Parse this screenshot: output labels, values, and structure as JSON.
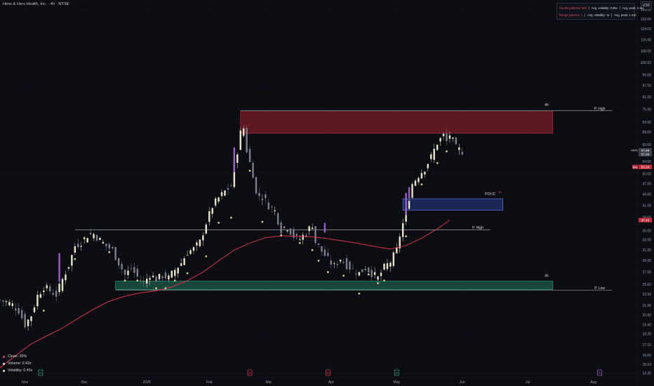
{
  "header": {
    "title": "Hims & Hers Health, Inc. · 4h · NYSE",
    "currency_button": "USD"
  },
  "info_box": {
    "row1": {
      "label": "Candle patterns: 503",
      "stat1": "Avg. volatility: 0.99x",
      "stat2": "Avg. peak: 2.11x"
    },
    "row2": {
      "label": "Range patterns: 1",
      "stat1": "Avg. volatility: 1x",
      "stat2": "Avg. peak: 1.42x"
    }
  },
  "legend": [
    {
      "label": "Close: 20%",
      "color": "#e04e6a"
    },
    {
      "label": "Volume: 0.42x",
      "color": "#e8e2c8"
    },
    {
      "label": "Volatility: 0.45x",
      "color": "#e8e2c8"
    }
  ],
  "colors": {
    "background": "#0b0d12",
    "up_candle": "#e8e2c8",
    "down_candle": "#7a7f8a",
    "ma_line": "#d9344f",
    "supply_zone": "#7a1c28",
    "demand_zone": "#1d5a4a",
    "poi_zone": "#1f2f6e",
    "purple_candle": "#9a5cc9",
    "price_badge": "#3a3f4a",
    "red_badge": "#c2303f"
  },
  "chart_data": {
    "type": "candlestick",
    "title": "Hims & Hers Health, Inc. · 4h · NYSE",
    "y_scale": "log",
    "ylim": [
      14.3,
      140
    ],
    "y_ticks": [
      "14.30",
      "15.10",
      "16.00",
      "17.10",
      "18.30",
      "19.40",
      "20.60",
      "21.90",
      "23.50",
      "25.00",
      "27.00",
      "29.00",
      "31.00",
      "33.00",
      "35.00",
      "38.00",
      "41.00",
      "44.00",
      "47.00",
      "50.00",
      "54.00",
      "57.00",
      "60.00",
      "65.00",
      "69.00",
      "75.00",
      "81.00",
      "87.00",
      "93.00",
      "100.50",
      "108.00",
      "116.00",
      "124.00",
      "132.00",
      "140.00"
    ],
    "y_tick_values": [
      14.3,
      15.1,
      16,
      17.1,
      18.3,
      19.4,
      20.6,
      21.9,
      23.5,
      25,
      27,
      29,
      31,
      33,
      35,
      38,
      41,
      44,
      47,
      50,
      54,
      57,
      60,
      65,
      69,
      75,
      81,
      87,
      93,
      100.5,
      108,
      116,
      124,
      132,
      140
    ],
    "x_labels": [
      "Nov",
      "Dec",
      "2025",
      "Feb",
      "Mar",
      "Apr",
      "May",
      "Jun",
      "Jul",
      "Aug"
    ],
    "x_label_index": [
      8,
      27,
      47,
      67,
      86,
      106,
      127,
      148,
      169,
      190
    ],
    "x_count": 205,
    "price_labels": [
      {
        "text": "HIMS",
        "value": 57.99,
        "kind": "ticker"
      },
      {
        "text": "57.99",
        "value": 57.99,
        "kind": "price"
      },
      {
        "text": "57.99",
        "value": 56.6,
        "kind": "price"
      },
      {
        "text": "52.24",
        "value": 52.24,
        "kind": "red"
      },
      {
        "text": "Box",
        "value": 52.24,
        "kind": "tag"
      },
      {
        "text": "37.42",
        "value": 37.42,
        "kind": "red"
      }
    ],
    "zones": [
      {
        "name": "supply",
        "from_index": 77,
        "to_index": 177,
        "low": 64.5,
        "high": 74.3
      },
      {
        "name": "poi",
        "from_index": 129,
        "to_index": 161,
        "low": 39.8,
        "high": 42.8
      },
      {
        "name": "demand",
        "from_index": 37,
        "to_index": 177,
        "low": 24.2,
        "high": 25.5
      }
    ],
    "levels": [
      {
        "name": "P. High",
        "value": 74.3,
        "from_index": 77,
        "to_index": 196,
        "label_index": 192
      },
      {
        "name": "P. High",
        "value": 35.2,
        "from_index": 24,
        "to_index": 157,
        "label_index": 153
      },
      {
        "name": "P. Low",
        "value": 24.1,
        "from_index": 37,
        "to_index": 196,
        "label_index": 192
      }
    ],
    "annotations": [
      {
        "text": "4h",
        "index": 175,
        "value": 76.5
      },
      {
        "text": "4h",
        "index": 175,
        "value": 26.2
      },
      {
        "text": "POI IC",
        "index": 157,
        "value": 43.8
      },
      {
        "text": "4H",
        "index": 160,
        "value": 44.4
      }
    ],
    "event_markers": [
      {
        "text": "D",
        "index": 13,
        "color": "#2a9d7a"
      },
      {
        "text": "E",
        "index": 80,
        "color": "#d9344f"
      },
      {
        "text": "D",
        "index": 105,
        "color": "#d9344f"
      },
      {
        "text": "D",
        "index": 127,
        "color": "#2a9d7a"
      },
      {
        "text": "E",
        "index": 192,
        "color": "#9a5cc9"
      }
    ],
    "close_path": [
      [
        0,
        22.6
      ],
      [
        2,
        22.4
      ],
      [
        4,
        22.0
      ],
      [
        6,
        21.2
      ],
      [
        8,
        19.4
      ],
      [
        10,
        20.6
      ],
      [
        12,
        23.3
      ],
      [
        14,
        24.6
      ],
      [
        16,
        24.0
      ],
      [
        18,
        23.4
      ],
      [
        20,
        25.8
      ],
      [
        22,
        28.2
      ],
      [
        24,
        31.8
      ],
      [
        26,
        32.6
      ],
      [
        28,
        34.0
      ],
      [
        30,
        34.3
      ],
      [
        32,
        33.0
      ],
      [
        34,
        31.8
      ],
      [
        36,
        31.0
      ],
      [
        38,
        28.6
      ],
      [
        40,
        26.5
      ],
      [
        42,
        27.6
      ],
      [
        44,
        26.2
      ],
      [
        46,
        25.2
      ],
      [
        48,
        26.6
      ],
      [
        50,
        25.8
      ],
      [
        52,
        26.4
      ],
      [
        54,
        26.0
      ],
      [
        56,
        27.4
      ],
      [
        58,
        28.6
      ],
      [
        60,
        30.6
      ],
      [
        62,
        31.2
      ],
      [
        64,
        32.6
      ],
      [
        66,
        36.8
      ],
      [
        68,
        40.8
      ],
      [
        70,
        43.0
      ],
      [
        72,
        44.8
      ],
      [
        74,
        46.4
      ],
      [
        75,
        54.0
      ],
      [
        76,
        57.8
      ],
      [
        77,
        64.6
      ],
      [
        78,
        66.6
      ],
      [
        79,
        58.0
      ],
      [
        80,
        53.6
      ],
      [
        81,
        50.0
      ],
      [
        82,
        44.0
      ],
      [
        84,
        43.4
      ],
      [
        86,
        41.0
      ],
      [
        88,
        39.6
      ],
      [
        90,
        35.2
      ],
      [
        92,
        35.8
      ],
      [
        94,
        33.8
      ],
      [
        96,
        33.2
      ],
      [
        98,
        34.6
      ],
      [
        100,
        36.4
      ],
      [
        101,
        32.6
      ],
      [
        103,
        30.8
      ],
      [
        105,
        29.2
      ],
      [
        107,
        28.0
      ],
      [
        109,
        29.4
      ],
      [
        111,
        28.2
      ],
      [
        113,
        27.4
      ],
      [
        115,
        26.8
      ],
      [
        117,
        27.8
      ],
      [
        119,
        26.8
      ],
      [
        121,
        26.0
      ],
      [
        123,
        27.8
      ],
      [
        125,
        28.8
      ],
      [
        127,
        31.0
      ],
      [
        128,
        34.0
      ],
      [
        129,
        36.6
      ],
      [
        130,
        39.6
      ],
      [
        131,
        43.2
      ],
      [
        132,
        47.0
      ],
      [
        134,
        49.6
      ],
      [
        136,
        51.8
      ],
      [
        138,
        55.6
      ],
      [
        140,
        60.8
      ],
      [
        142,
        63.6
      ],
      [
        143,
        61.2
      ],
      [
        144,
        64.0
      ],
      [
        146,
        58.8
      ],
      [
        148,
        57.6
      ]
    ],
    "ma_path": [
      [
        0,
        14.8
      ],
      [
        5,
        16.0
      ],
      [
        10,
        17.2
      ],
      [
        15,
        18.1
      ],
      [
        20,
        19.0
      ],
      [
        25,
        20.2
      ],
      [
        30,
        21.4
      ],
      [
        35,
        22.5
      ],
      [
        40,
        23.2
      ],
      [
        45,
        23.7
      ],
      [
        50,
        24.0
      ],
      [
        55,
        24.6
      ],
      [
        60,
        25.6
      ],
      [
        65,
        27.0
      ],
      [
        70,
        29.0
      ],
      [
        75,
        31.0
      ],
      [
        80,
        32.4
      ],
      [
        85,
        33.5
      ],
      [
        90,
        33.9
      ],
      [
        95,
        33.8
      ],
      [
        100,
        33.7
      ],
      [
        105,
        33.3
      ],
      [
        110,
        32.8
      ],
      [
        115,
        32.3
      ],
      [
        120,
        31.7
      ],
      [
        125,
        31.2
      ],
      [
        130,
        31.9
      ],
      [
        135,
        33.4
      ],
      [
        140,
        35.4
      ],
      [
        144,
        37.42
      ]
    ],
    "markers_below": [
      [
        14,
        21.2
      ],
      [
        24,
        29.3
      ],
      [
        35,
        30.6
      ],
      [
        40,
        25.6
      ],
      [
        44,
        25.6
      ],
      [
        50,
        24.4
      ],
      [
        53,
        24.4
      ],
      [
        56,
        25.6
      ],
      [
        60,
        26.8
      ],
      [
        66,
        29.8
      ],
      [
        70,
        36.8
      ],
      [
        74,
        38.0
      ],
      [
        80,
        51.0
      ],
      [
        84,
        37.0
      ],
      [
        90,
        34.0
      ],
      [
        96,
        32.4
      ],
      [
        100,
        31.0
      ],
      [
        102,
        29.0
      ],
      [
        105,
        27.0
      ],
      [
        110,
        26.4
      ],
      [
        115,
        23.6
      ],
      [
        118,
        26.6
      ],
      [
        121,
        25.2
      ],
      [
        123,
        25.6
      ],
      [
        127,
        30.5
      ],
      [
        130,
        33.8
      ],
      [
        135,
        46.8
      ],
      [
        140,
        53.5
      ],
      [
        143,
        57.6
      ]
    ],
    "purple_candles": [
      {
        "index": 19,
        "low": 25.5,
        "high": 30.4
      },
      {
        "index": 75,
        "low": 50.5,
        "high": 59.0
      },
      {
        "index": 104,
        "low": 34.6,
        "high": 36.8
      },
      {
        "index": 130,
        "low": 38.6,
        "high": 44.4
      },
      {
        "index": 131,
        "low": 43.0,
        "high": 46.0
      }
    ]
  }
}
